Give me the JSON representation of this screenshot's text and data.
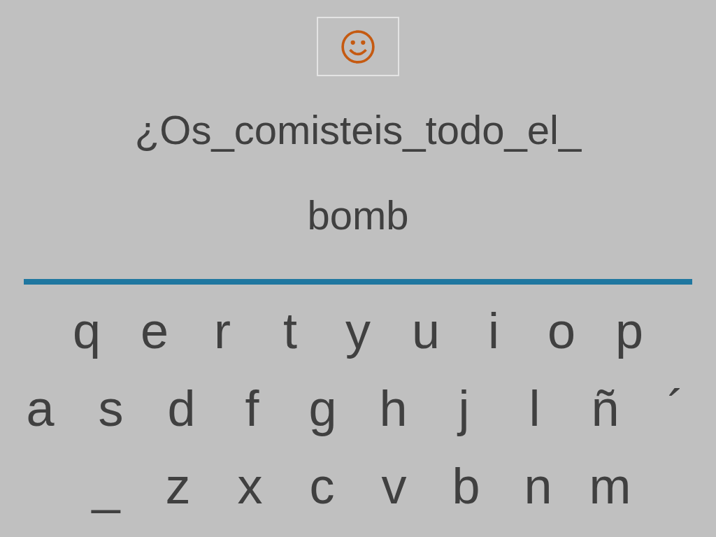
{
  "prompt_lines": [
    "¿Os_comisteis_todo_el_",
    "bomb"
  ],
  "keyboard": [
    [
      "q",
      "e",
      "r",
      "t",
      "y",
      "u",
      "i",
      "o",
      "p"
    ],
    [
      "a",
      "s",
      "d",
      "f",
      "g",
      "h",
      "j",
      "l",
      "ñ",
      "´"
    ],
    [
      "_",
      "z",
      "x",
      "c",
      "v",
      "b",
      "n",
      "m"
    ]
  ]
}
